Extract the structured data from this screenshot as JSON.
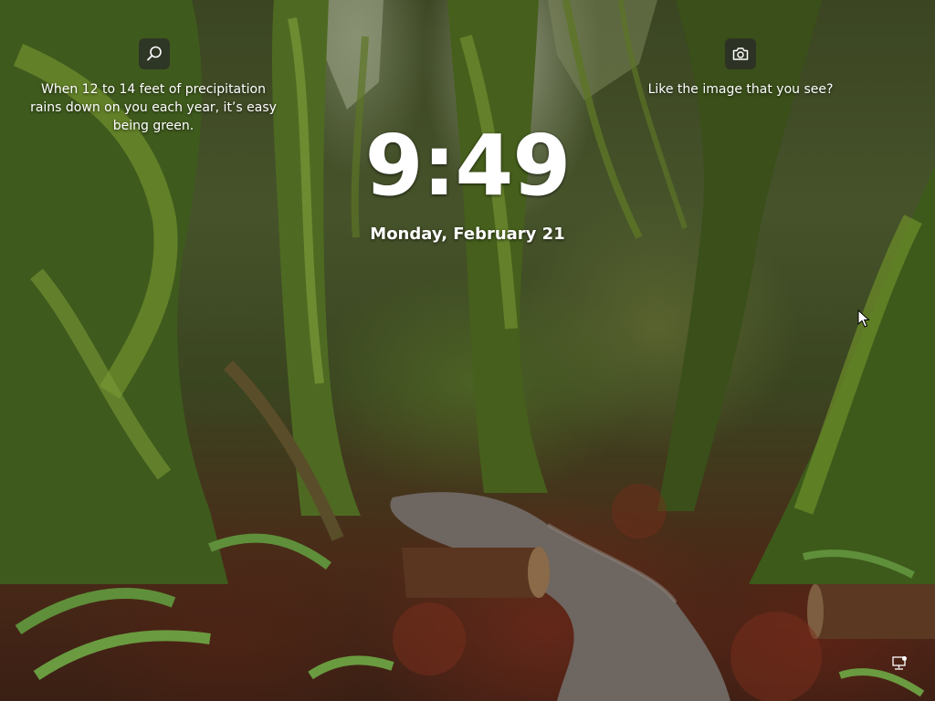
{
  "lockscreen": {
    "spotlight_fact": "When 12 to 14 feet of precipitation rains down on you each year, it’s easy being green.",
    "like_prompt": "Like the image that you see?",
    "time": "9:49",
    "date": "Monday, February 21"
  },
  "icons": {
    "search": "search-icon",
    "camera": "camera-icon",
    "network": "network-icon",
    "cursor": "mouse-pointer"
  },
  "colors": {
    "text": "#ffffff",
    "icon_button_bg": "#282828",
    "foliage": "#4f6b23",
    "path": "#6e6a66",
    "leaf_litter": "#7a2e1c"
  }
}
